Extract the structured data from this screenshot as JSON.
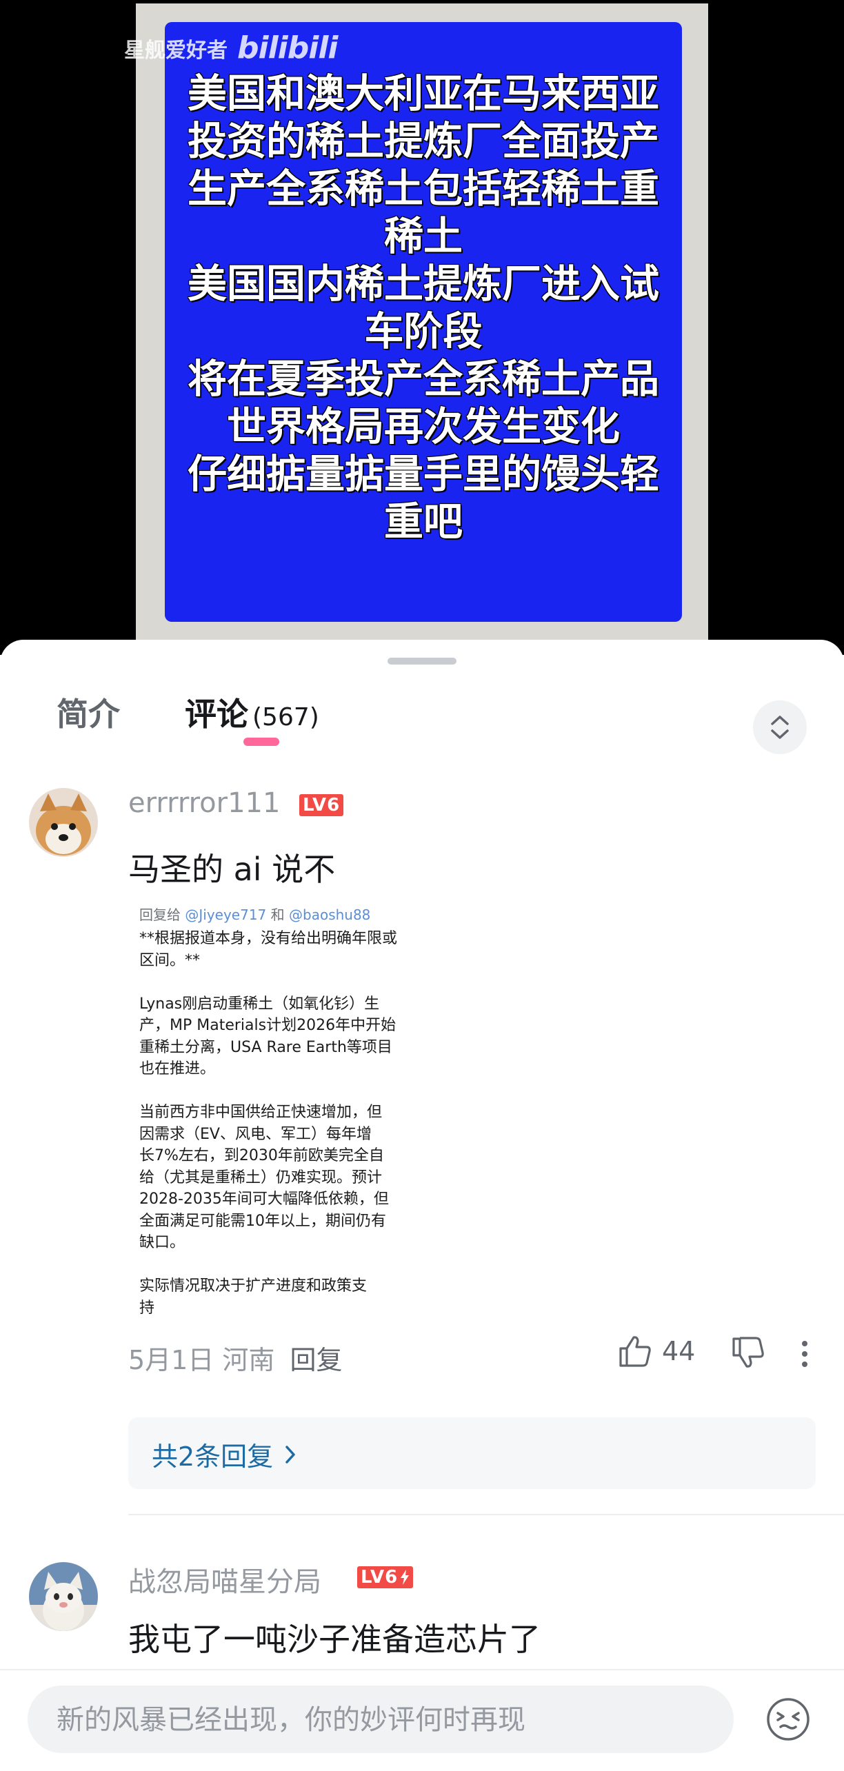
{
  "video": {
    "watermark_channel": "星舰爱好者",
    "watermark_logo": "bilibili",
    "slide_text": "美国和澳大利亚在马来西亚\n投资的稀土提炼厂全面投产\n生产全系稀土包括轻稀土重\n稀土\n美国国内稀土提炼厂进入试\n车阶段\n将在夏季投产全系稀土产品\n世界格局再次发生变化\n仔细掂量掂量手里的馒头轻\n重吧"
  },
  "tabs": {
    "intro_label": "简介",
    "comments_label": "评论",
    "comments_count": "(567)",
    "accent_color": "#ff6699"
  },
  "comments": [
    {
      "username": "errrrror111",
      "level": "LV6",
      "text": "马圣的 ai 说不",
      "quote_image": {
        "reply_prefix": "回复给 ",
        "mention_1": "@Jiyeye717",
        "mention_join": " 和 ",
        "mention_2": "@baoshu88",
        "body": "**根据报道本身，没有给出明确年限或\n区间。**\n\nLynas刚启动重稀土（如氧化钐）生\n产，MP Materials计划2026年中开始\n重稀土分离，USA Rare Earth等项目\n也在推进。\n\n当前西方非中国供给正快速增加，但\n因需求（EV、风电、军工）每年增\n长7%左右，到2030年前欧美完全自\n给（尤其是重稀土）仍难实现。预计\n2028-2035年间可大幅降低依赖，但\n全面满足可能需10年以上，期间仍有\n缺口。\n\n实际情况取决于扩产进度和政策支\n持"
      },
      "date_location": "5月1日 河南",
      "reply_label": "回复",
      "likes": "44",
      "replies_link": "共2条回复"
    },
    {
      "username": "战忽局喵星分局",
      "level": "LV6",
      "text": "我屯了一吨沙子准备造芯片了"
    }
  ],
  "input": {
    "placeholder": "新的风暴已经出现，你的妙评何时再现"
  }
}
